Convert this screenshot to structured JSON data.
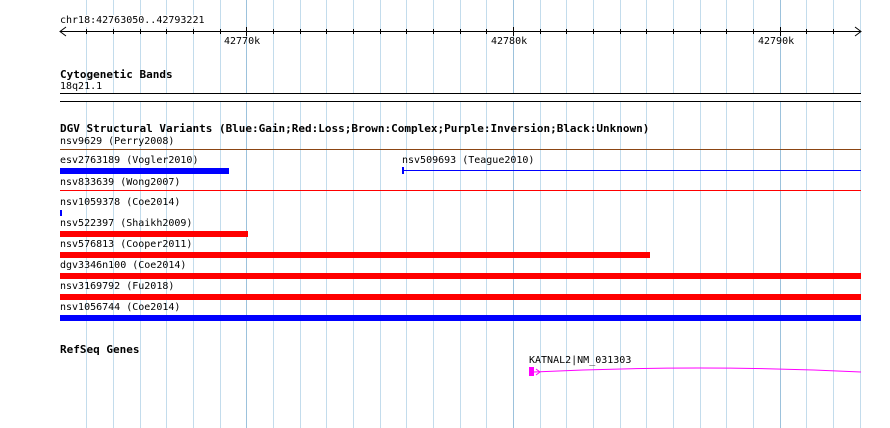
{
  "ruler": {
    "location": "chr18:42763050..42793221",
    "ticks": [
      "42770k",
      "42780k",
      "42790k"
    ]
  },
  "tracks": {
    "cytoband": {
      "title": "Cytogenetic Bands",
      "band": "18q21.1"
    },
    "dgv": {
      "title": "DGV Structural Variants (Blue:Gain;Red:Loss;Brown:Complex;Purple:Inversion;Black:Unknown)",
      "variants": [
        {
          "label": "nsv9629 (Perry2008)",
          "type": "complex"
        },
        {
          "label": "esv2763189 (Vogler2010)",
          "type": "gain"
        },
        {
          "label": "nsv509693 (Teague2010)",
          "type": "gain"
        },
        {
          "label": "nsv833639 (Wong2007)",
          "type": "loss"
        },
        {
          "label": "nsv1059378 (Coe2014)",
          "type": "gain"
        },
        {
          "label": "nsv522397 (Shaikh2009)",
          "type": "loss"
        },
        {
          "label": "nsv576813 (Cooper2011)",
          "type": "loss"
        },
        {
          "label": "dgv3346n100 (Coe2014)",
          "type": "loss"
        },
        {
          "label": "nsv3169792 (Fu2018)",
          "type": "loss"
        },
        {
          "label": "nsv1056744 (Coe2014)",
          "type": "gain"
        }
      ]
    },
    "refseq": {
      "title": "RefSeq Genes",
      "gene": "KATNAL2|NM_031303"
    }
  },
  "colors": {
    "gain": "#0000ff",
    "loss": "#ff0000",
    "complex": "#8b4513",
    "gene": "#ff00ff",
    "grid": "#c3dcec"
  }
}
